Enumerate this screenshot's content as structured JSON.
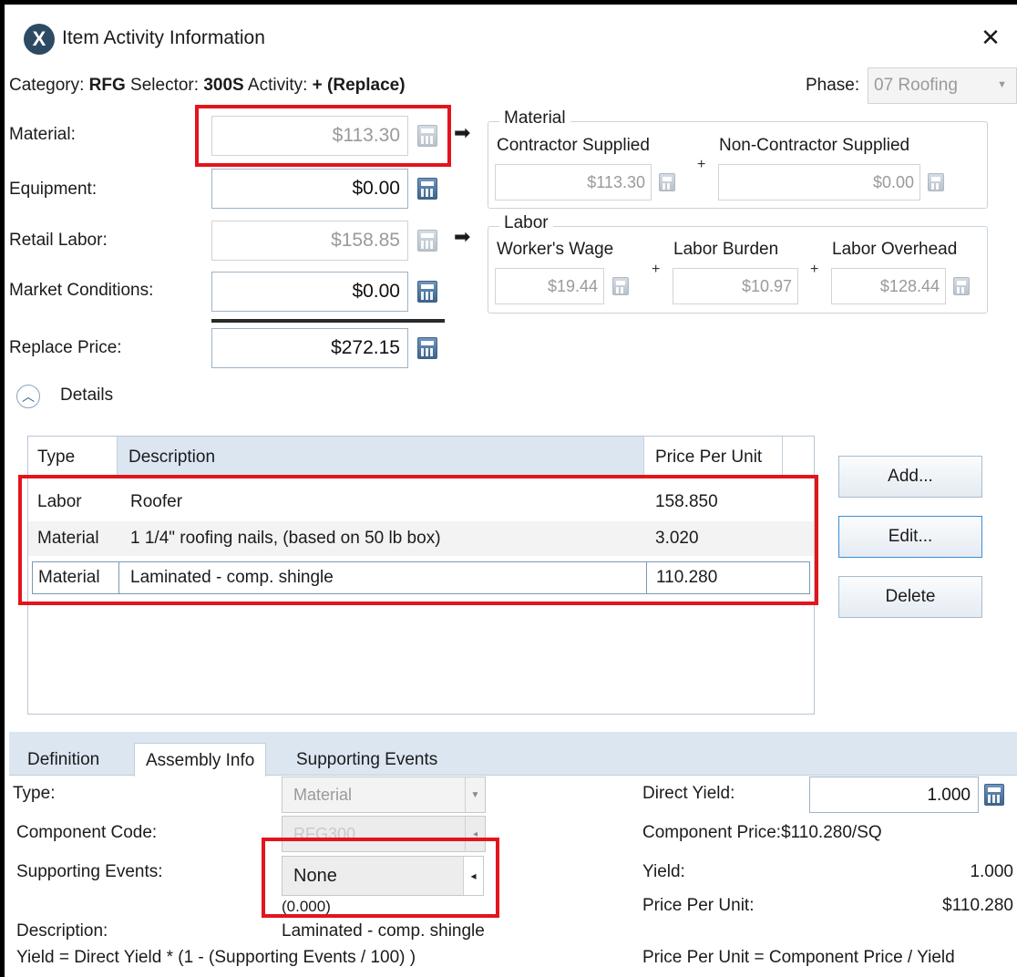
{
  "window": {
    "title": "Item Activity Information",
    "close_glyph": "✕"
  },
  "category_line": {
    "category_label": "Category:",
    "category_value": "RFG",
    "selector_label": "Selector:",
    "selector_value": "300S",
    "activity_label": "Activity:",
    "activity_value": "+ (Replace)"
  },
  "phase": {
    "label": "Phase:",
    "value": "07 Roofing"
  },
  "fields": {
    "material": {
      "label": "Material:",
      "value": "$113.30"
    },
    "equipment": {
      "label": "Equipment:",
      "value": "$0.00"
    },
    "retail_labor": {
      "label": "Retail Labor:",
      "value": "$158.85"
    },
    "market_conditions": {
      "label": "Market Conditions:",
      "value": "$0.00"
    },
    "replace_price": {
      "label": "Replace Price:",
      "value": "$272.15"
    }
  },
  "material_group": {
    "title": "Material",
    "contractor_label": "Contractor Supplied",
    "contractor_value": "$113.30",
    "plus": "+",
    "non_contractor_label": "Non-Contractor Supplied",
    "non_contractor_value": "$0.00"
  },
  "labor_group": {
    "title": "Labor",
    "wage_label": "Worker's Wage",
    "wage_value": "$19.44",
    "plus": "+",
    "burden_label": "Labor Burden",
    "burden_value": "$10.97",
    "overhead_label": "Labor Overhead",
    "overhead_value": "$128.44"
  },
  "details": {
    "toggle_label": "Details",
    "columns": [
      "Type",
      "Description",
      "Price Per Unit"
    ],
    "rows": [
      [
        "Labor",
        "Roofer",
        "158.850"
      ],
      [
        "Material",
        "1 1/4\" roofing nails, (based on 50 lb box)",
        "3.020"
      ],
      [
        "Material",
        "Laminated - comp. shingle",
        "110.280"
      ]
    ],
    "buttons": {
      "add": "Add...",
      "edit": "Edit...",
      "delete": "Delete"
    }
  },
  "tabs": [
    "Definition",
    "Assembly Info",
    "Supporting Events"
  ],
  "assembly": {
    "type_label": "Type:",
    "type_value": "Material",
    "component_code_label": "Component Code:",
    "component_code_value": "RFG300",
    "supporting_events_label": "Supporting Events:",
    "supporting_events_value": "None",
    "supporting_events_sub": "(0.000)",
    "description_label": "Description:",
    "description_value": "Laminated - comp. shingle",
    "yield_formula": "Yield = Direct Yield * (1 - (Supporting Events / 100) )",
    "direct_yield_label": "Direct Yield:",
    "direct_yield_value": "1.000",
    "component_price_label": "Component Price:",
    "component_price_value": "$110.280/SQ",
    "yield_label": "Yield:",
    "yield_value": "1.000",
    "price_per_unit_label": "Price Per Unit:",
    "price_per_unit_value": "$110.280",
    "ppu_formula": "Price Per Unit = Component Price / Yield"
  },
  "colors": {
    "highlight": "#e3141c",
    "accent": "#3a8fd8",
    "header_bg": "#dbe6f1"
  }
}
